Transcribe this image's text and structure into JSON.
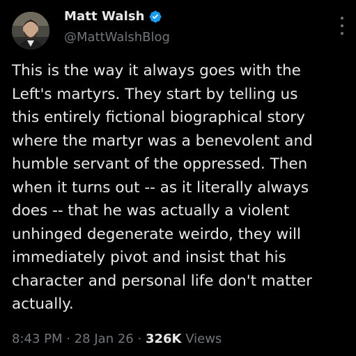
{
  "author": {
    "display_name": "Matt Walsh",
    "handle": "@MattWalshBlog",
    "verified": true,
    "verified_color": "#1d9bf0"
  },
  "tweet": {
    "text": "This is the way it always goes with the\nLeft's martyrs. They start by telling us\nthis entirely fictional biographical story\nwhere the martyr was a benevolent and\nhumble servant of the oppressed. Then\nwhen it turns out -- as it literally always\ndoes -- that he was actually a violent\nunhinged degenerate weirdo, they will\nimmediately pivot and insist that his\ncharacter and personal life don't matter\nactually."
  },
  "meta": {
    "time": "8:43 PM",
    "date": "28 Jan 26",
    "separator": "·",
    "views_count": "326K",
    "views_label": "Views"
  },
  "icons": {
    "more": "more-vertical-icon",
    "verified": "verified-badge-icon"
  },
  "colors": {
    "background": "#000000",
    "primary_text": "#e7e9ea",
    "secondary_text": "#71767b"
  }
}
